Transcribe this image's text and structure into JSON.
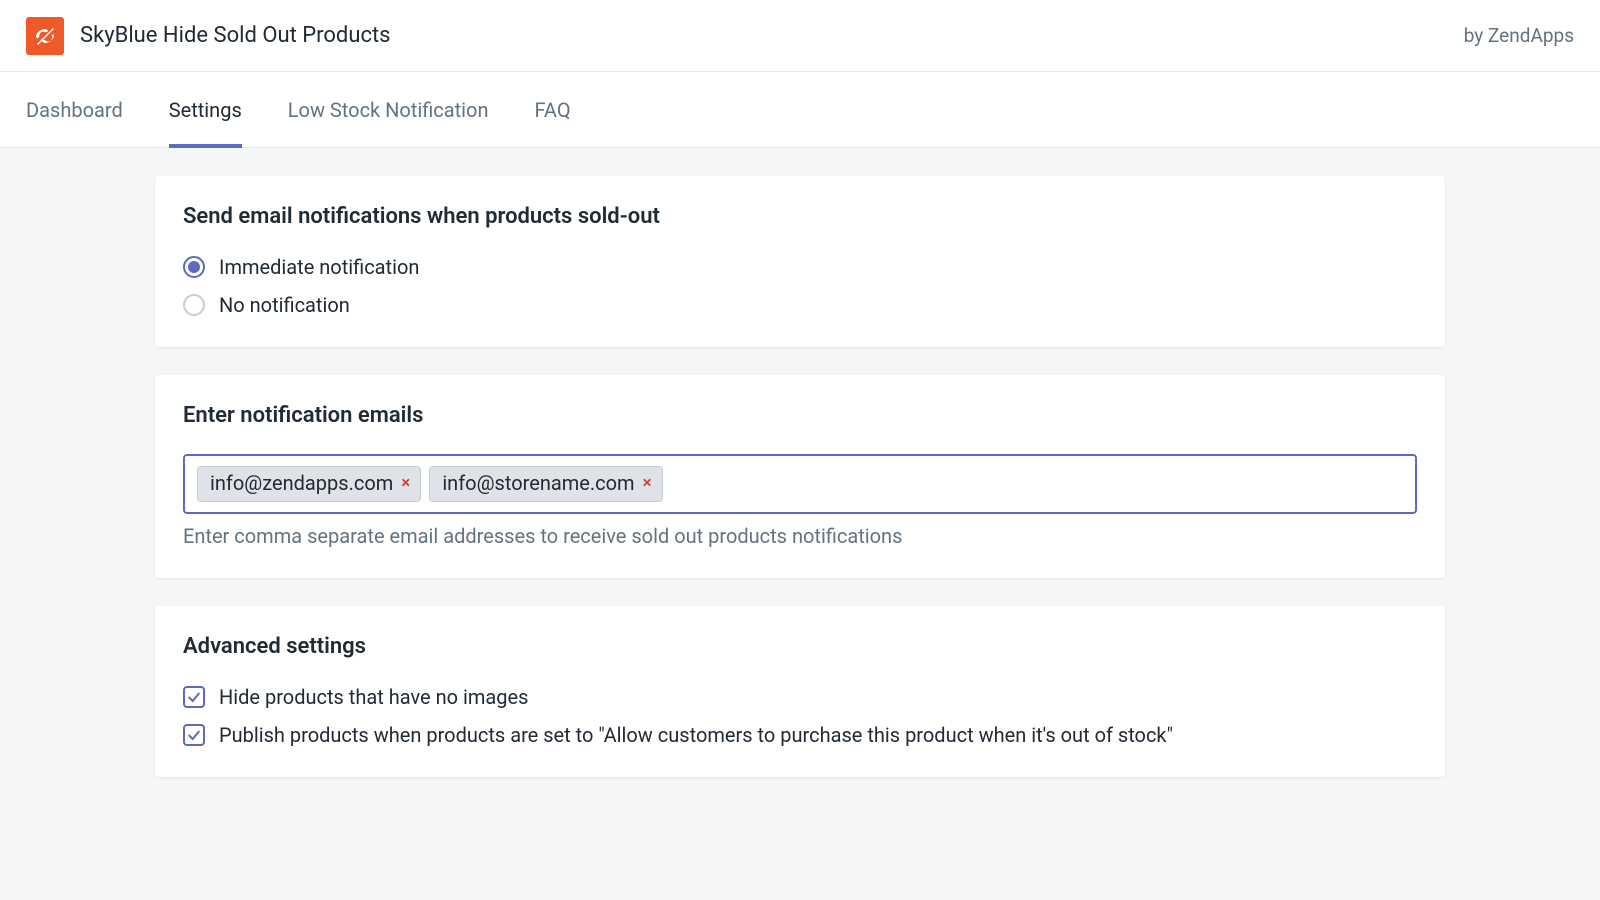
{
  "header": {
    "app_title": "SkyBlue Hide Sold Out Products",
    "byline": "by ZendApps"
  },
  "tabs": [
    {
      "label": "Dashboard",
      "active": false
    },
    {
      "label": "Settings",
      "active": true
    },
    {
      "label": "Low Stock Notification",
      "active": false
    },
    {
      "label": "FAQ",
      "active": false
    }
  ],
  "card_notify": {
    "title": "Send email notifications when products sold-out",
    "options": [
      {
        "label": "Immediate notification",
        "checked": true
      },
      {
        "label": "No notification",
        "checked": false
      }
    ]
  },
  "card_emails": {
    "title": "Enter notification emails",
    "tags": [
      "info@zendapps.com",
      "info@storename.com"
    ],
    "remove_symbol": "×",
    "helptext": "Enter comma separate email addresses to receive sold out products notifications"
  },
  "card_advanced": {
    "title": "Advanced settings",
    "options": [
      {
        "label": "Hide products that have no images",
        "checked": true
      },
      {
        "label": "Publish products when products are set to \"Allow customers to purchase this product when it's out of stock\"",
        "checked": true
      }
    ]
  }
}
